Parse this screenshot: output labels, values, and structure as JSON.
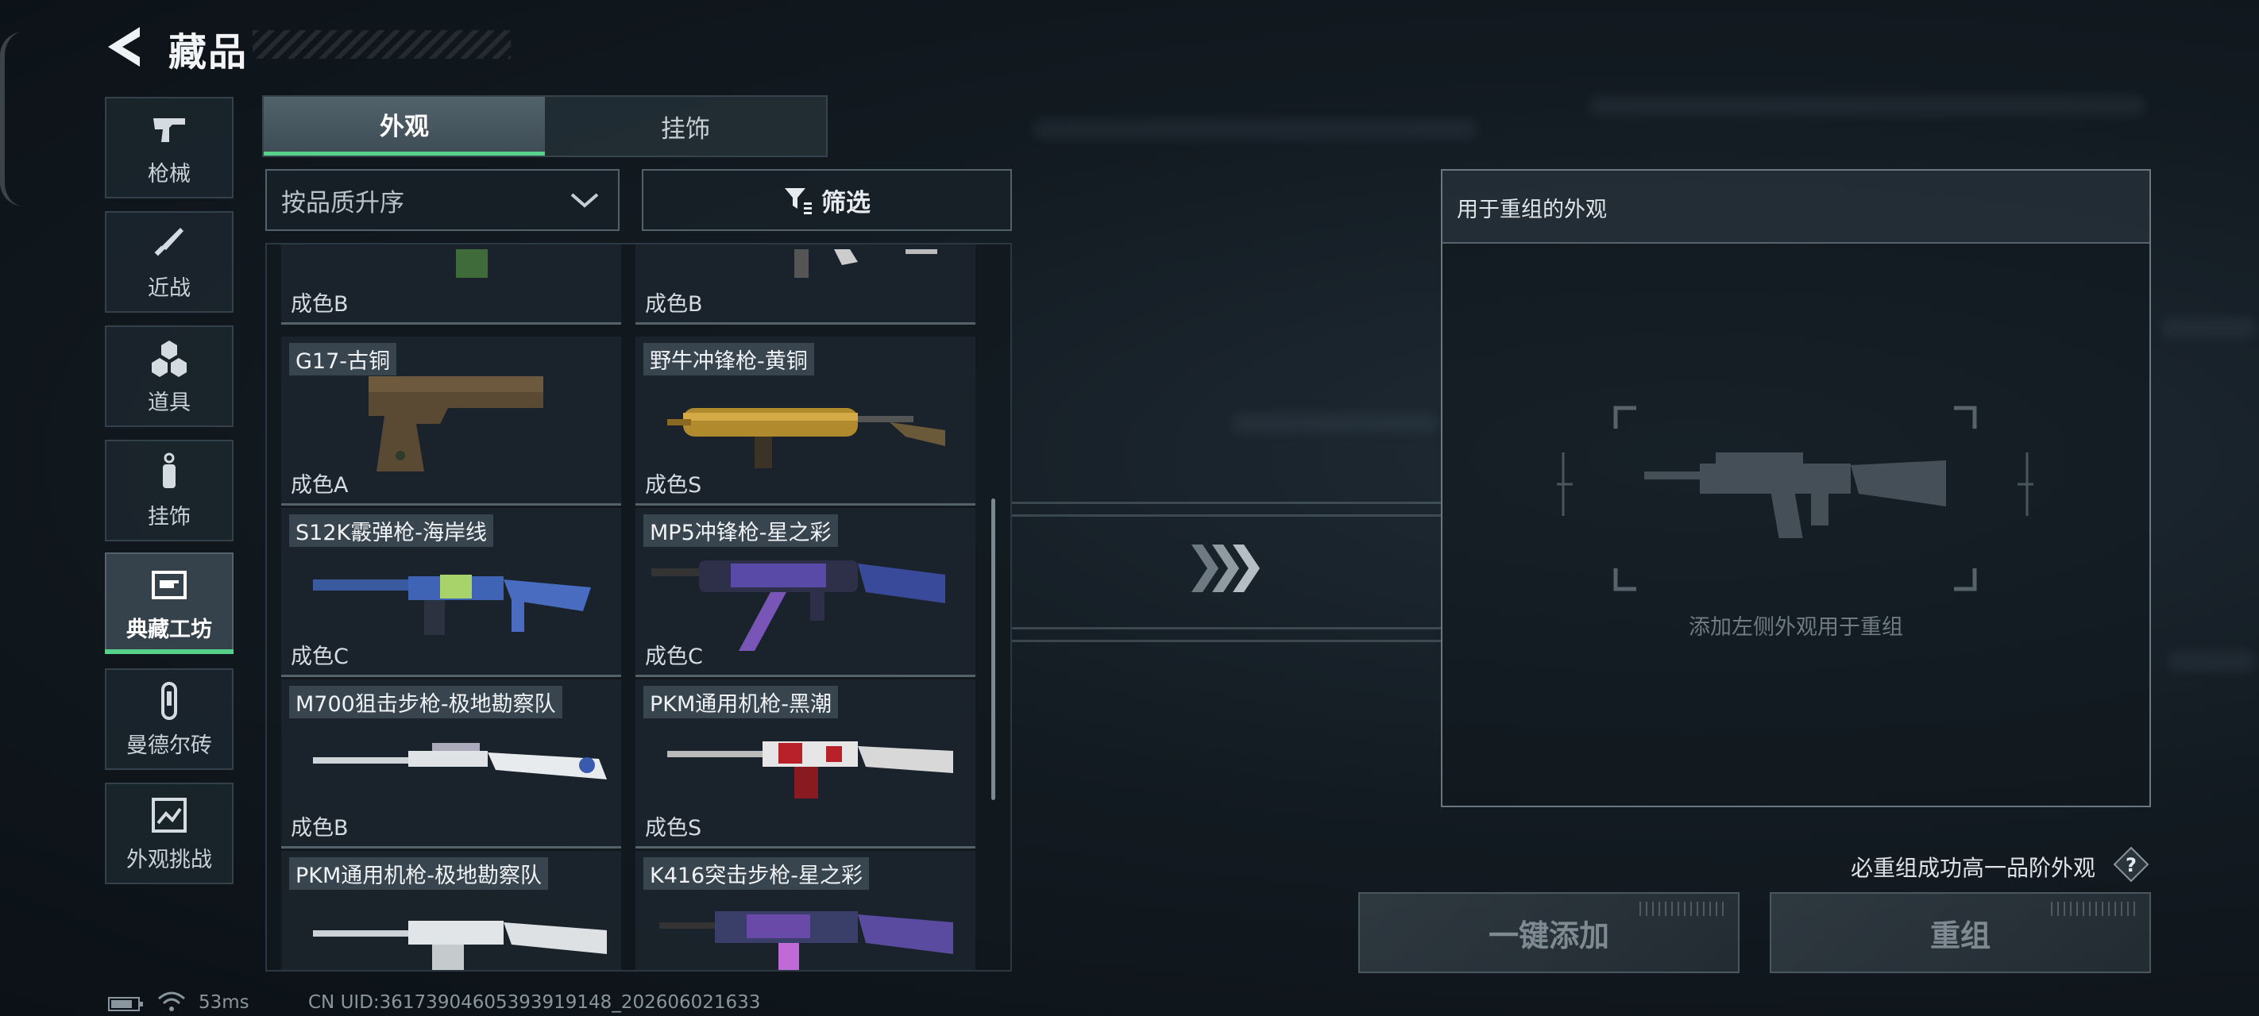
{
  "header": {
    "title": "藏品",
    "back_icon": "back-arrow-icon"
  },
  "nav": {
    "items": [
      {
        "label": "枪械",
        "icon": "pistol-icon"
      },
      {
        "label": "近战",
        "icon": "knife-icon"
      },
      {
        "label": "道具",
        "icon": "grenade-icon"
      },
      {
        "label": "挂饰",
        "icon": "charm-icon"
      },
      {
        "label": "典藏工坊",
        "icon": "workshop-icon",
        "active": true
      },
      {
        "label": "曼德尔砖",
        "icon": "brick-icon"
      },
      {
        "label": "外观挑战",
        "icon": "challenge-icon"
      }
    ]
  },
  "tabs": [
    {
      "label": "外观",
      "active": true
    },
    {
      "label": "挂饰",
      "active": false
    }
  ],
  "sort": {
    "label": "按品质升序"
  },
  "filter": {
    "label": "筛选"
  },
  "items": [
    {
      "name": "",
      "grade": "成色B"
    },
    {
      "name": "",
      "grade": "成色B"
    },
    {
      "name": "G17-古铜",
      "grade": "成色A"
    },
    {
      "name": "野牛冲锋枪-黄铜",
      "grade": "成色S"
    },
    {
      "name": "S12K霰弹枪-海岸线",
      "grade": "成色C"
    },
    {
      "name": "MP5冲锋枪-星之彩",
      "grade": "成色C"
    },
    {
      "name": "M700狙击步枪-极地勘察队",
      "grade": "成色B"
    },
    {
      "name": "PKM通用机枪-黑潮",
      "grade": "成色S"
    },
    {
      "name": "PKM通用机枪-极地勘察队",
      "grade": ""
    },
    {
      "name": "K416突击步枪-星之彩",
      "grade": ""
    }
  ],
  "recombine": {
    "title": "用于重组的外观",
    "hint": "添加左侧外观用于重组",
    "guarantee": "必重组成功高一品阶外观",
    "help_icon": "question-icon",
    "add_all_label": "一键添加",
    "recombine_label": "重组"
  },
  "status": {
    "ping": "53ms",
    "uid": "CN UID:3617390460539391914​8_202606021633"
  },
  "colors": {
    "accent": "#57d28b",
    "panel_border": "#6a7780"
  }
}
